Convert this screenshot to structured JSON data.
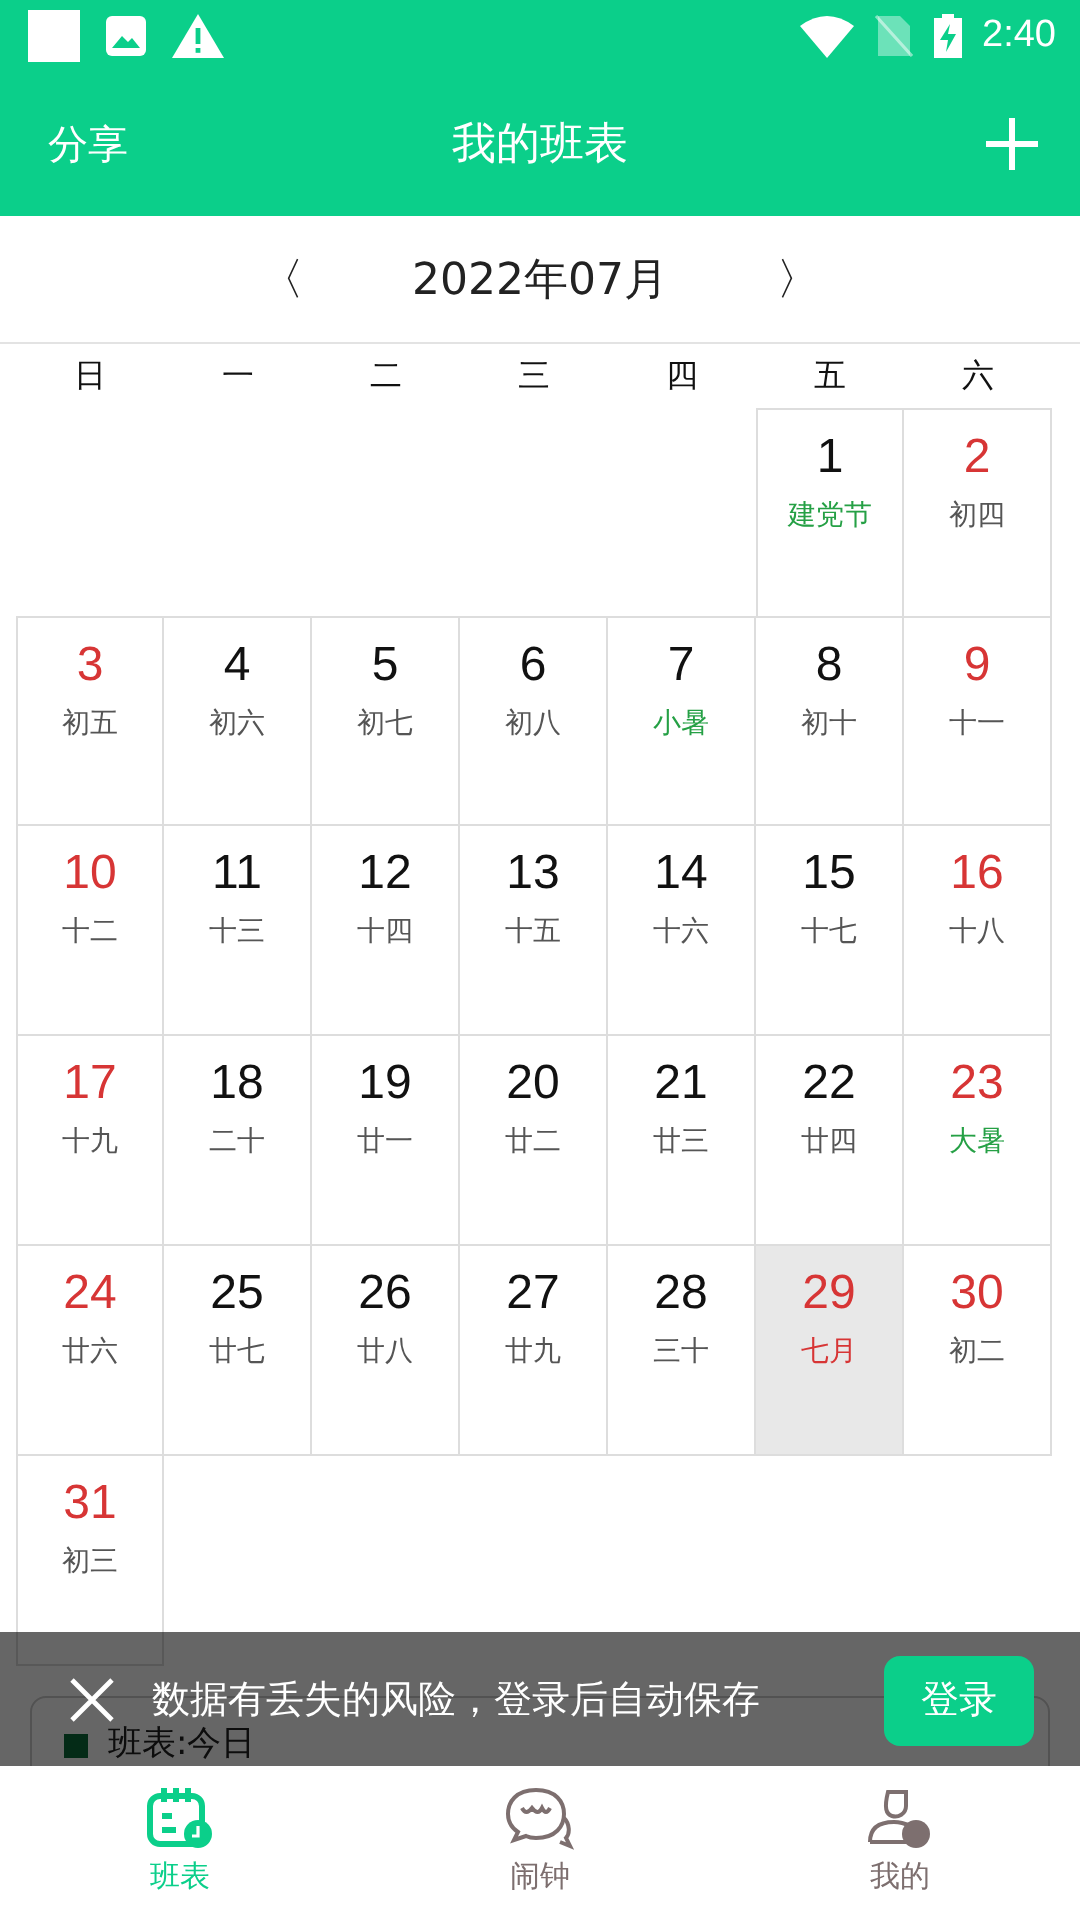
{
  "status_bar": {
    "time": "2:40"
  },
  "app_bar": {
    "left": "分享",
    "title": "我的班表"
  },
  "month_nav": {
    "prev": "〈",
    "label": "2022年07月",
    "next": "〉"
  },
  "weekdays": [
    "日",
    "一",
    "二",
    "三",
    "四",
    "五",
    "六"
  ],
  "weeks": [
    [
      {
        "kind": "blank"
      },
      {
        "kind": "blank"
      },
      {
        "kind": "blank"
      },
      {
        "kind": "blank"
      },
      {
        "kind": "blank"
      },
      {
        "kind": "day",
        "day": "1",
        "sub": "建党节",
        "weekend": false,
        "festival": true,
        "today": false
      },
      {
        "kind": "day",
        "day": "2",
        "sub": "初四",
        "weekend": true,
        "festival": false,
        "today": false
      }
    ],
    [
      {
        "kind": "day",
        "day": "3",
        "sub": "初五",
        "weekend": true,
        "festival": false,
        "today": false
      },
      {
        "kind": "day",
        "day": "4",
        "sub": "初六",
        "weekend": false,
        "festival": false,
        "today": false
      },
      {
        "kind": "day",
        "day": "5",
        "sub": "初七",
        "weekend": false,
        "festival": false,
        "today": false
      },
      {
        "kind": "day",
        "day": "6",
        "sub": "初八",
        "weekend": false,
        "festival": false,
        "today": false
      },
      {
        "kind": "day",
        "day": "7",
        "sub": "小暑",
        "weekend": false,
        "festival": true,
        "today": false
      },
      {
        "kind": "day",
        "day": "8",
        "sub": "初十",
        "weekend": false,
        "festival": false,
        "today": false
      },
      {
        "kind": "day",
        "day": "9",
        "sub": "十一",
        "weekend": true,
        "festival": false,
        "today": false
      }
    ],
    [
      {
        "kind": "day",
        "day": "10",
        "sub": "十二",
        "weekend": true,
        "festival": false,
        "today": false
      },
      {
        "kind": "day",
        "day": "11",
        "sub": "十三",
        "weekend": false,
        "festival": false,
        "today": false
      },
      {
        "kind": "day",
        "day": "12",
        "sub": "十四",
        "weekend": false,
        "festival": false,
        "today": false
      },
      {
        "kind": "day",
        "day": "13",
        "sub": "十五",
        "weekend": false,
        "festival": false,
        "today": false
      },
      {
        "kind": "day",
        "day": "14",
        "sub": "十六",
        "weekend": false,
        "festival": false,
        "today": false
      },
      {
        "kind": "day",
        "day": "15",
        "sub": "十七",
        "weekend": false,
        "festival": false,
        "today": false
      },
      {
        "kind": "day",
        "day": "16",
        "sub": "十八",
        "weekend": true,
        "festival": false,
        "today": false
      }
    ],
    [
      {
        "kind": "day",
        "day": "17",
        "sub": "十九",
        "weekend": true,
        "festival": false,
        "today": false
      },
      {
        "kind": "day",
        "day": "18",
        "sub": "二十",
        "weekend": false,
        "festival": false,
        "today": false
      },
      {
        "kind": "day",
        "day": "19",
        "sub": "廿一",
        "weekend": false,
        "festival": false,
        "today": false
      },
      {
        "kind": "day",
        "day": "20",
        "sub": "廿二",
        "weekend": false,
        "festival": false,
        "today": false
      },
      {
        "kind": "day",
        "day": "21",
        "sub": "廿三",
        "weekend": false,
        "festival": false,
        "today": false
      },
      {
        "kind": "day",
        "day": "22",
        "sub": "廿四",
        "weekend": false,
        "festival": false,
        "today": false
      },
      {
        "kind": "day",
        "day": "23",
        "sub": "大暑",
        "weekend": true,
        "festival": true,
        "today": false
      }
    ],
    [
      {
        "kind": "day",
        "day": "24",
        "sub": "廿六",
        "weekend": true,
        "festival": false,
        "today": false
      },
      {
        "kind": "day",
        "day": "25",
        "sub": "廿七",
        "weekend": false,
        "festival": false,
        "today": false
      },
      {
        "kind": "day",
        "day": "26",
        "sub": "廿八",
        "weekend": false,
        "festival": false,
        "today": false
      },
      {
        "kind": "day",
        "day": "27",
        "sub": "廿九",
        "weekend": false,
        "festival": false,
        "today": false
      },
      {
        "kind": "day",
        "day": "28",
        "sub": "三十",
        "weekend": false,
        "festival": false,
        "today": false
      },
      {
        "kind": "day",
        "day": "29",
        "sub": "七月",
        "weekend": false,
        "festival": false,
        "today": true
      },
      {
        "kind": "day",
        "day": "30",
        "sub": "初二",
        "weekend": true,
        "festival": false,
        "today": false
      }
    ],
    [
      {
        "kind": "day",
        "day": "31",
        "sub": "初三",
        "weekend": true,
        "festival": false,
        "today": false
      }
    ]
  ],
  "card": {
    "title": "班表:今日"
  },
  "banner": {
    "message": "数据有丢失的风险，登录后自动保存",
    "button": "登录"
  },
  "tabs": [
    {
      "label": "班表",
      "selected": true
    },
    {
      "label": "闹钟",
      "selected": false
    },
    {
      "label": "我的",
      "selected": false
    }
  ]
}
